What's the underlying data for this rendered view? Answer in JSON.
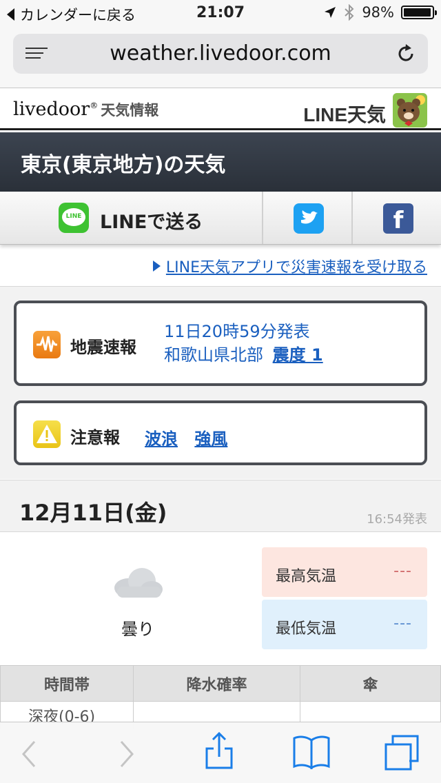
{
  "status_bar": {
    "back_label": "カレンダーに戻る",
    "time": "21:07",
    "battery": "98%",
    "battery_level": 0.98,
    "icons": [
      "location-arrow-icon",
      "bluetooth-icon",
      "battery-icon"
    ]
  },
  "browser": {
    "url": "weather.livedoor.com",
    "icons": [
      "reader-menu-icon",
      "reload-icon"
    ]
  },
  "site_header": {
    "logo": "livedoor",
    "logo_mark": "®",
    "logo_sub": "天気情報",
    "line_weather": "LINE天気"
  },
  "page": {
    "title": "東京(東京地方)の天気"
  },
  "share": {
    "line_label": "LINEで送る",
    "line_icon_text": "LINE",
    "facebook_letter": "f",
    "icons": [
      "line-icon",
      "twitter-icon",
      "facebook-icon"
    ]
  },
  "app_link": "LINE天気アプリで災害速報を受け取る",
  "earthquake": {
    "heading": "地震速報",
    "announced": "11日20時59分発表",
    "region": "和歌山県北部",
    "intensity": "震度 1"
  },
  "advisory": {
    "heading": "注意報",
    "items": [
      "波浪",
      "強風"
    ]
  },
  "forecast": {
    "date": "12月11日(金)",
    "published": "16:54発表",
    "condition": "曇り",
    "high_label": "最高気温",
    "high_value": "---",
    "low_label": "最低気温",
    "low_value": "---"
  },
  "table": {
    "headers": [
      "時間帯",
      "降水確率",
      "傘"
    ],
    "first_cell": "深夜(0-6)"
  },
  "colors": {
    "link": "#1a5fbf",
    "title_bar": "#2f3640",
    "line_green": "#3ec232",
    "twitter": "#1da1f2",
    "facebook": "#3b5998",
    "high_bg": "#fde6e0",
    "low_bg": "#e0f0fc"
  },
  "toolbar_icons": [
    "back-icon",
    "forward-icon",
    "share-icon",
    "bookmarks-icon",
    "tabs-icon"
  ]
}
